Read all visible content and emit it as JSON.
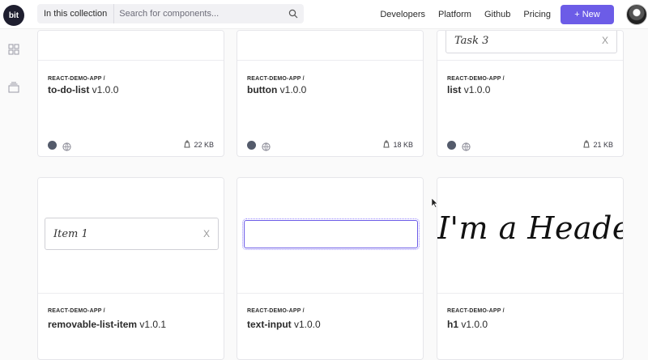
{
  "header": {
    "logo_text": "bit",
    "scope_label": "In this collection",
    "search_placeholder": "Search for components...",
    "nav": [
      "Developers",
      "Platform",
      "Github",
      "Pricing"
    ],
    "new_button": "+ New"
  },
  "colors": {
    "accent": "#6c5ce7",
    "status_dot": "#545b6b"
  },
  "rail_icons": [
    "grid-icon",
    "collection-icon"
  ],
  "cards": [
    {
      "scope": "REACT-DEMO-APP /",
      "name": "to-do-list",
      "version": "v1.0.0",
      "size": "22 KB"
    },
    {
      "scope": "REACT-DEMO-APP /",
      "name": "button",
      "version": "v1.0.0",
      "size": "18 KB"
    },
    {
      "scope": "REACT-DEMO-APP /",
      "name": "list",
      "version": "v1.0.0",
      "size": "21 KB",
      "preview_text": "Task 3",
      "preview_close": "X"
    },
    {
      "scope": "REACT-DEMO-APP /",
      "name": "removable-list-item",
      "version": "v1.0.1",
      "preview_text": "Item 1",
      "preview_close": "X"
    },
    {
      "scope": "REACT-DEMO-APP /",
      "name": "text-input",
      "version": "v1.0.0"
    },
    {
      "scope": "REACT-DEMO-APP /",
      "name": "h1",
      "version": "v1.0.0",
      "preview_text": "I'm a Header"
    }
  ]
}
